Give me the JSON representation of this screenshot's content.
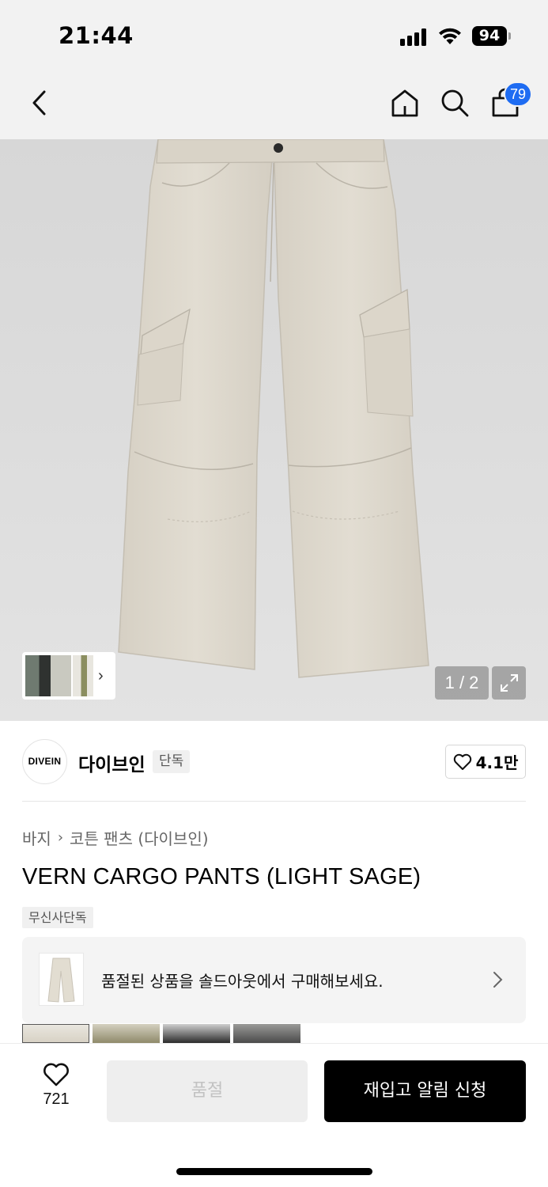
{
  "status_bar": {
    "time": "21:44",
    "battery": "94",
    "icons": [
      "signal-icon",
      "wifi-icon",
      "battery-icon"
    ]
  },
  "nav": {
    "icons": [
      "back-chevron-icon",
      "home-icon",
      "search-icon",
      "cart-icon"
    ],
    "cart_badge": "79"
  },
  "gallery": {
    "page_indicator": "1 / 2",
    "icons": [
      "chevron-right-icon",
      "expand-icon"
    ],
    "image_colors": {
      "background": "#dcdcdc",
      "pants": "#ddd7cc"
    }
  },
  "brand": {
    "logo_text": "DIVEIN",
    "name": "다이브인",
    "tag": "단독",
    "like_count": "4.1만"
  },
  "product": {
    "breadcrumb": [
      "바지",
      "코튼 팬츠 (다이브인)"
    ],
    "title": "VERN CARGO PANTS (LIGHT SAGE)",
    "exclusive_tag": "무신사단독",
    "soldout_banner_text": "품절된 상품을 솔드아웃에서 구매해보세요.",
    "swatch_colors": [
      "#d8d2c5",
      "#8f8a6a",
      "#2b2b2b",
      "#6e6e6e"
    ]
  },
  "bottom_bar": {
    "wish_count": "721",
    "soldout_label": "품절",
    "restock_label": "재입고 알림 신청",
    "colors": {
      "primary": "#000000",
      "disabled_bg": "#eeeeee",
      "disabled_text": "#c2c2c2",
      "badge": "#1e6cf2"
    }
  }
}
